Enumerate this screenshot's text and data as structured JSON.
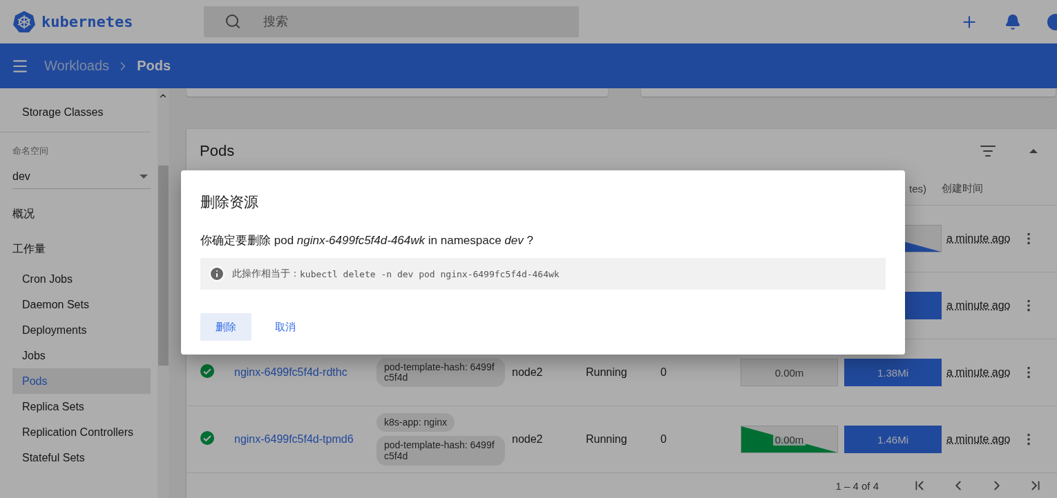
{
  "header": {
    "logo_text": "kubernetes",
    "search": {
      "placeholder": "搜索"
    }
  },
  "breadcrumb": {
    "parent": "Workloads",
    "current": "Pods"
  },
  "sidebar": {
    "top_items": [
      {
        "label": "Storage Classes",
        "selected": false
      }
    ],
    "namespace": {
      "label": "命名空间",
      "value": "dev"
    },
    "sections": [
      {
        "label": "概况"
      },
      {
        "label": "工作量",
        "children": [
          {
            "label": "Cron Jobs",
            "selected": false
          },
          {
            "label": "Daemon Sets",
            "selected": false
          },
          {
            "label": "Deployments",
            "selected": false
          },
          {
            "label": "Jobs",
            "selected": false
          },
          {
            "label": "Pods",
            "selected": true
          },
          {
            "label": "Replica Sets",
            "selected": false
          },
          {
            "label": "Replication Controllers",
            "selected": false
          },
          {
            "label": "Stateful Sets",
            "selected": false
          }
        ]
      }
    ]
  },
  "pods_card": {
    "title": "Pods",
    "columns": [
      "tes)",
      "创建时间"
    ],
    "rows": [
      {
        "memory": {
          "kind": "falling"
        },
        "created": "a minute ago"
      },
      {
        "memory": {
          "kind": "full"
        },
        "created": "a minute ago"
      },
      {
        "name": "nginx-6499fc5f4d-rdthc",
        "labels": [
          "pod-template-hash: 6499fc5f4d"
        ],
        "node": "node2",
        "phase": "Running",
        "restarts": "0",
        "cpu": {
          "kind": "empty",
          "reading": "0.00m"
        },
        "memory": {
          "kind": "full",
          "reading": "1.38Mi"
        },
        "created": "a minute ago"
      },
      {
        "name": "nginx-6499fc5f4d-tpmd6",
        "labels": [
          "k8s-app: nginx",
          "pod-template-hash: 6499fc5f4d"
        ],
        "node": "node2",
        "phase": "Running",
        "restarts": "0",
        "cpu": {
          "kind": "falling",
          "reading": "0.00m"
        },
        "memory": {
          "kind": "full",
          "reading": "1.46Mi"
        },
        "created": "a minute ago"
      }
    ],
    "pagination": "1 – 4 of 4"
  },
  "dialog": {
    "title": "删除资源",
    "message": "你确定要删除 pod *nginx-6499fc5f4d-464wk*  in namespace *dev* ?",
    "info_label": "此操作相当于：",
    "command": "kubectl delete -n dev pod nginx-6499fc5f4d-464wk",
    "buttons": [
      {
        "label": "删除",
        "kind": "primary"
      },
      {
        "label": "取消",
        "kind": "text"
      }
    ]
  }
}
